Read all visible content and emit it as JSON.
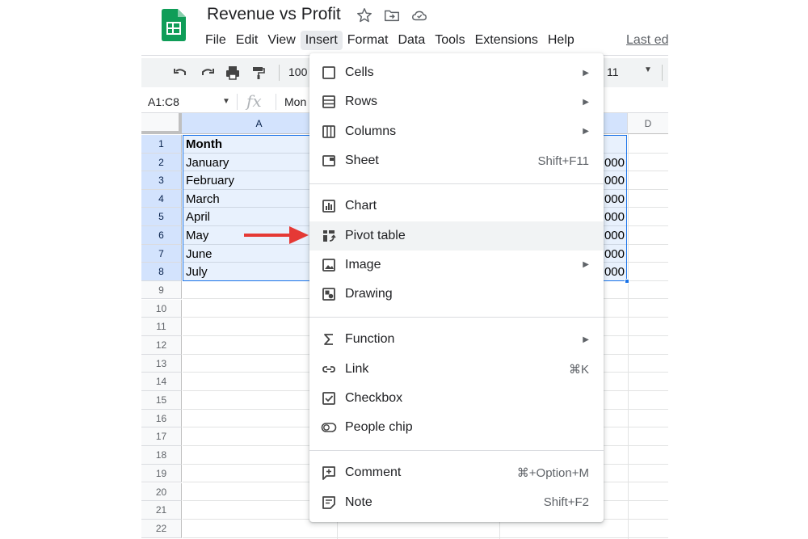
{
  "document": {
    "title": "Revenue vs Profit"
  },
  "menubar": {
    "items": [
      "File",
      "Edit",
      "View",
      "Insert",
      "Format",
      "Data",
      "Tools",
      "Extensions",
      "Help"
    ],
    "active": "Insert",
    "last_edit": "Last ed"
  },
  "toolbar": {
    "zoom": "100",
    "font_size": "11"
  },
  "formula_bar": {
    "name_box": "A1:C8",
    "fx": "fx",
    "content": "Mon"
  },
  "grid": {
    "columns": [
      "A",
      "D"
    ],
    "rows": [
      "1",
      "2",
      "3",
      "4",
      "5",
      "6",
      "7",
      "8",
      "9",
      "10",
      "11",
      "12",
      "13",
      "14",
      "15",
      "16",
      "17",
      "18",
      "19",
      "20",
      "21",
      "22"
    ],
    "column_a": [
      "Month",
      "January",
      "February",
      "March",
      "April",
      "May",
      "June",
      "July"
    ],
    "column_c_visible": [
      "000",
      "000",
      "000",
      "000",
      "000",
      "000",
      "000"
    ]
  },
  "insert_menu": {
    "groups": [
      [
        {
          "label": "Cells",
          "icon": "square-icon",
          "submenu": true
        },
        {
          "label": "Rows",
          "icon": "rows-icon",
          "submenu": true
        },
        {
          "label": "Columns",
          "icon": "columns-icon",
          "submenu": true
        },
        {
          "label": "Sheet",
          "icon": "sheet-icon",
          "shortcut": "Shift+F11"
        }
      ],
      [
        {
          "label": "Chart",
          "icon": "chart-icon"
        },
        {
          "label": "Pivot table",
          "icon": "pivot-table-icon",
          "hovered": true
        },
        {
          "label": "Image",
          "icon": "image-icon",
          "submenu": true
        },
        {
          "label": "Drawing",
          "icon": "drawing-icon"
        }
      ],
      [
        {
          "label": "Function",
          "icon": "sigma-icon",
          "submenu": true
        },
        {
          "label": "Link",
          "icon": "link-icon",
          "shortcut": "⌘K"
        },
        {
          "label": "Checkbox",
          "icon": "checkbox-icon"
        },
        {
          "label": "People chip",
          "icon": "person-chip-icon"
        }
      ],
      [
        {
          "label": "Comment",
          "icon": "comment-icon",
          "shortcut": "⌘+Option+M"
        },
        {
          "label": "Note",
          "icon": "note-icon",
          "shortcut": "Shift+F2"
        }
      ]
    ]
  },
  "colors": {
    "selection": "#1a73e8",
    "sheets_green": "#0f9d58",
    "arrow": "#e53935",
    "menu_hover": "#f1f3f4"
  }
}
